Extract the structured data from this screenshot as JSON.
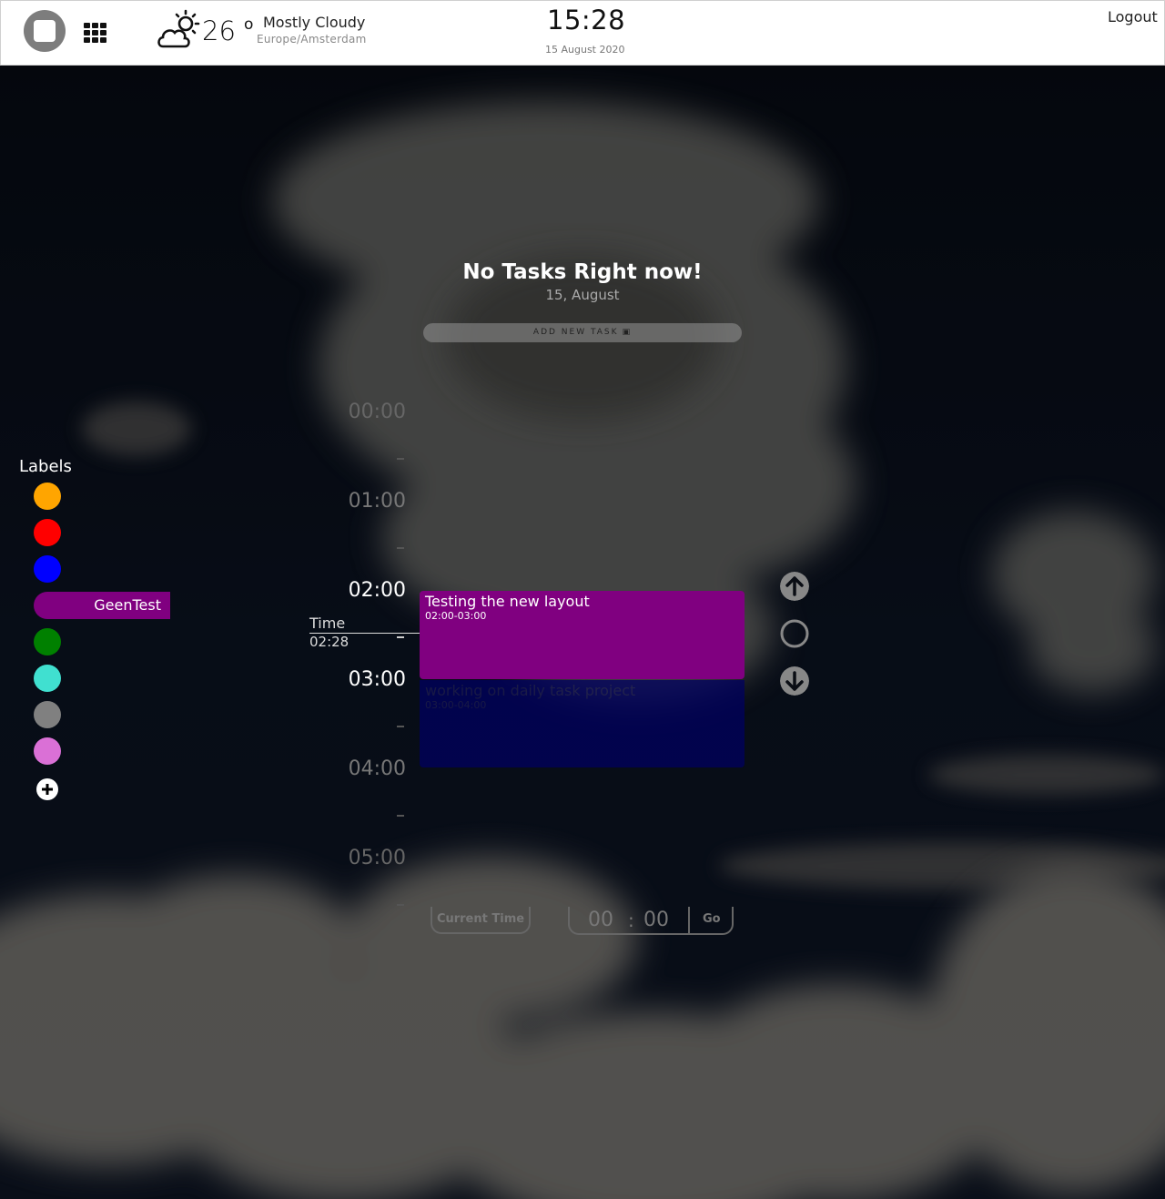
{
  "header": {
    "temperature": "26",
    "degree_symbol": "o",
    "condition": "Mostly Cloudy",
    "timezone": "Europe/Amsterdam",
    "clock": "15:28",
    "date": "15 August 2020",
    "logout_label": "Logout",
    "weather_icon": "cloud-sun-icon"
  },
  "main": {
    "heading": "No Tasks Right now!",
    "subheading": "15, August",
    "add_task_label": "ADD NEW TASK"
  },
  "labels": {
    "title": "Labels",
    "items": [
      {
        "color": "#ffa500",
        "name": ""
      },
      {
        "color": "#ff0000",
        "name": ""
      },
      {
        "color": "#0000ff",
        "name": ""
      },
      {
        "color": "#800080",
        "name": "GeenTest"
      },
      {
        "color": "#008000",
        "name": ""
      },
      {
        "color": "#40e0d0",
        "name": ""
      },
      {
        "color": "#808080",
        "name": ""
      },
      {
        "color": "#da70d6",
        "name": ""
      }
    ]
  },
  "timeline": {
    "hours": [
      "00:00",
      "01:00",
      "02:00",
      "03:00",
      "04:00",
      "05:00"
    ],
    "tick": "-",
    "time_label": "Time",
    "time_value": "02:28",
    "tasks": [
      {
        "title": "Testing the new layout",
        "range": "02:00-03:00",
        "color": "#800080"
      },
      {
        "title": "working on daily task project",
        "range": "03:00-04:00",
        "color": "#000060"
      }
    ]
  },
  "controls": {
    "current_time_label": "Current Time",
    "goto_hour": "00",
    "goto_minute": "00",
    "goto_colon": ":",
    "go_label": "Go"
  }
}
